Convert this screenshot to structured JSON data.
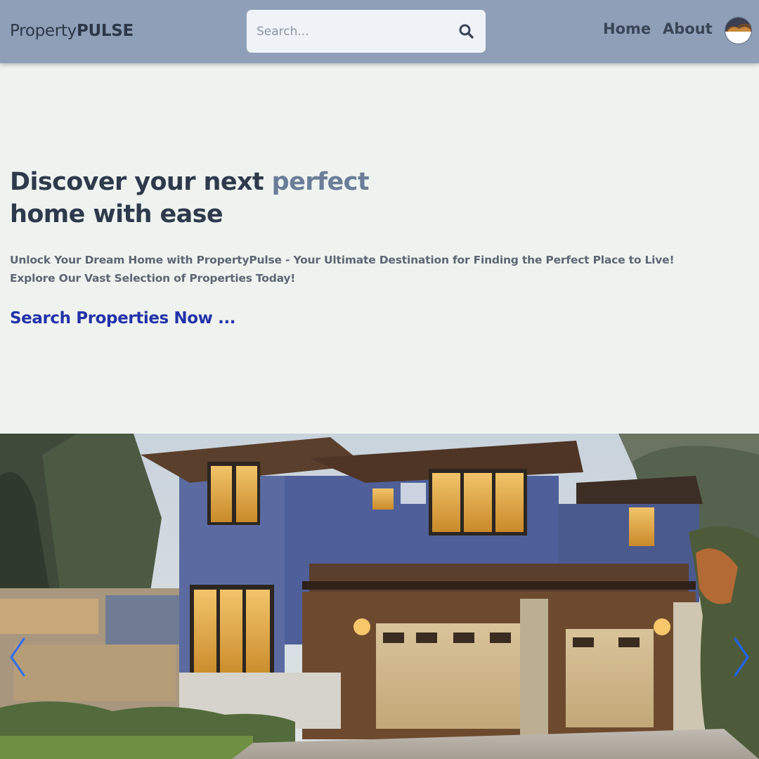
{
  "header": {
    "logo_regular": "Property",
    "logo_bold": "PULSE",
    "search_placeholder": "Search...",
    "nav": [
      {
        "label": "Home"
      },
      {
        "label": "About"
      }
    ],
    "search_icon": "search-icon",
    "avatar": "user-avatar"
  },
  "hero": {
    "title_part1": "Discover your next ",
    "title_accent": "perfect",
    "title_line2": "home with ease",
    "subtitle_line1": "Unlock Your Dream Home with PropertyPulse - Your Ultimate Destination for Finding the Perfect Place to Live!",
    "subtitle_line2": "Explore Our Vast Selection of Properties Today!",
    "cta_label": "Search Properties Now ..."
  },
  "carousel": {
    "image": "modern two-story house with garage",
    "prev_icon": "chevron-left-icon",
    "next_icon": "chevron-right-icon"
  },
  "colors": {
    "navbar": "#8e9fb7",
    "background": "#eff3f0",
    "accent_text": "#6a7d98",
    "cta": "#2332a8",
    "arrow": "#1d64ff"
  }
}
